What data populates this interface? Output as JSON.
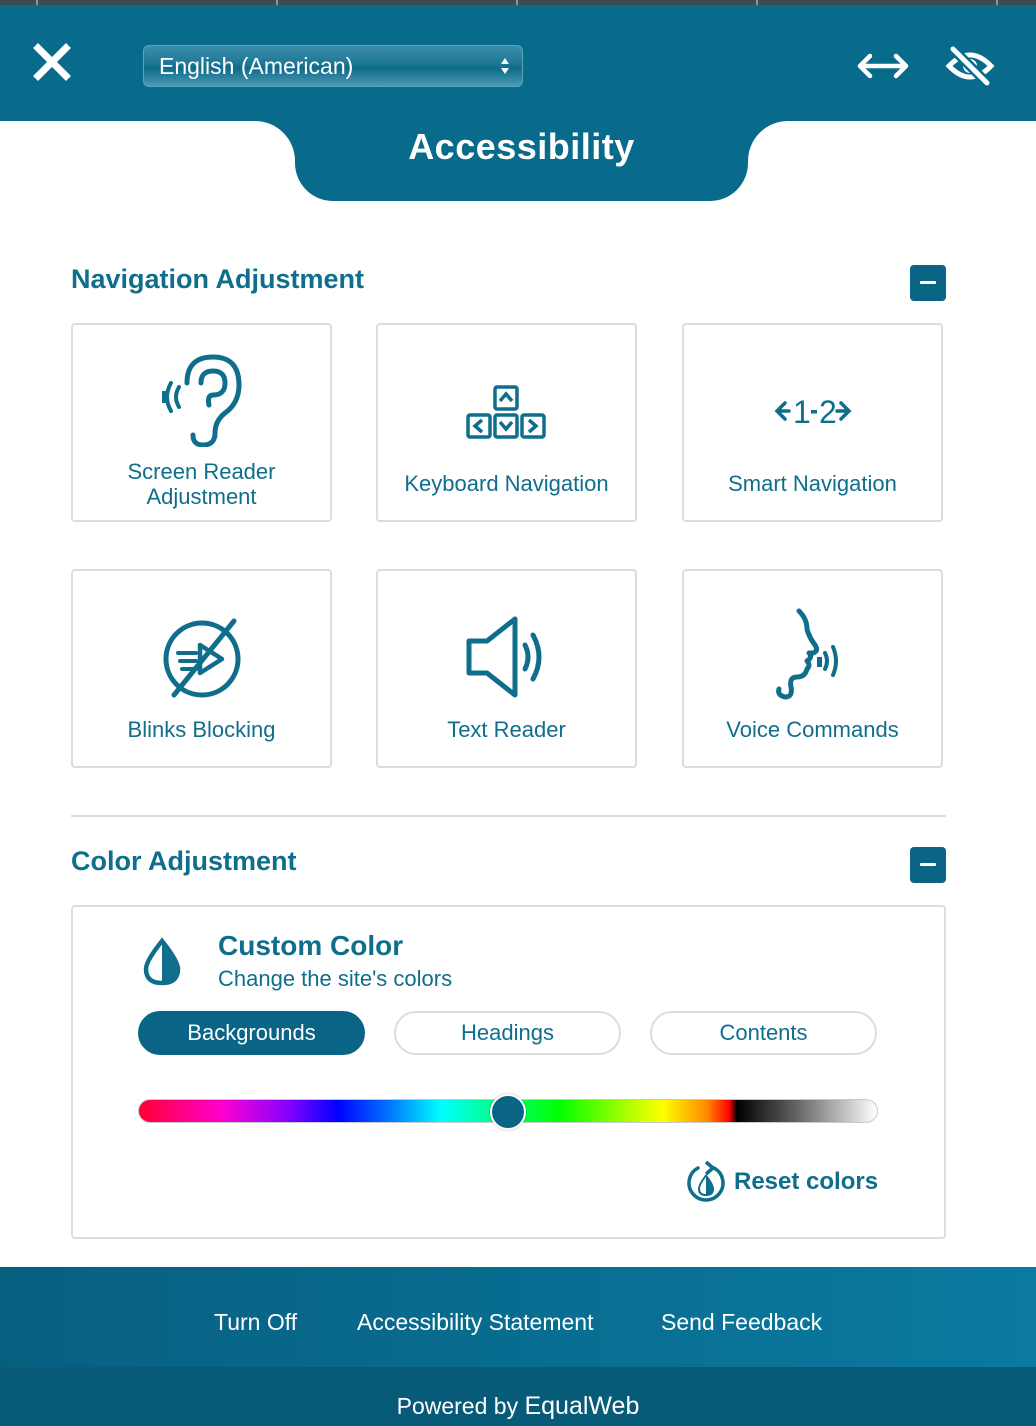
{
  "header": {
    "language": "English (American)",
    "title": "Accessibility"
  },
  "navigation_section": {
    "title": "Navigation Adjustment",
    "cards": [
      {
        "label": "Screen Reader Adjustment",
        "icon": "ear-icon"
      },
      {
        "label": "Keyboard Navigation",
        "icon": "keyboard-arrows-icon"
      },
      {
        "label": "Smart Navigation",
        "icon": "smart-navigation-icon"
      },
      {
        "label": "Blinks Blocking",
        "icon": "blink-block-icon"
      },
      {
        "label": "Text Reader",
        "icon": "speaker-icon"
      },
      {
        "label": "Voice Commands",
        "icon": "voice-face-icon"
      }
    ]
  },
  "color_section": {
    "title": "Color Adjustment",
    "custom_color": {
      "title": "Custom Color",
      "subtitle": "Change the site's colors",
      "icon": "color-drop-icon"
    },
    "targets": [
      "Backgrounds",
      "Headings",
      "Contents"
    ],
    "selected_target": "Backgrounds",
    "slider_value": 0.5,
    "reset_label": "Reset colors"
  },
  "footer": {
    "links": [
      "Turn Off",
      "Accessibility Statement",
      "Send Feedback"
    ],
    "powered_prefix": "Powered by",
    "powered_brand": "EqualWeb"
  },
  "colors": {
    "primary": "#086b8c",
    "accent_text": "#0f6e8c",
    "border": "#d9dde0"
  }
}
